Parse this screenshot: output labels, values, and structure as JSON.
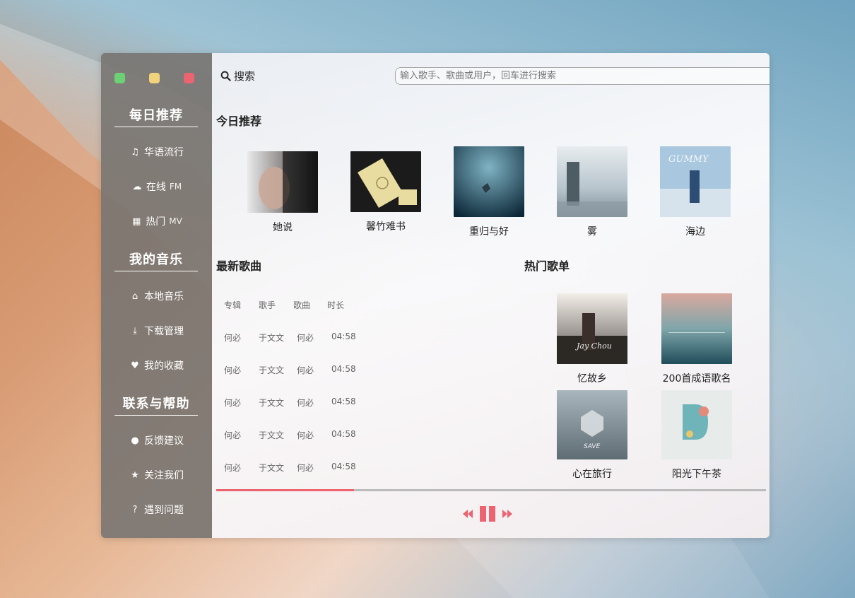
{
  "sidebar": {
    "sections": [
      {
        "title": "每日推荐",
        "items": [
          {
            "icon": "music-note-icon",
            "label": "华语流行",
            "en": ""
          },
          {
            "icon": "cloud-icon",
            "label": "在线",
            "en": "FM"
          },
          {
            "icon": "film-icon",
            "label": "热门",
            "en": "MV"
          }
        ]
      },
      {
        "title": "我的音乐",
        "items": [
          {
            "icon": "home-icon",
            "label": "本地音乐",
            "en": ""
          },
          {
            "icon": "download-icon",
            "label": "下载管理",
            "en": ""
          },
          {
            "icon": "heart-icon",
            "label": "我的收藏",
            "en": ""
          }
        ]
      },
      {
        "title": "联系与帮助",
        "items": [
          {
            "icon": "comment-icon",
            "label": "反馈建议",
            "en": ""
          },
          {
            "icon": "star-icon",
            "label": "关注我们",
            "en": ""
          },
          {
            "icon": "question-icon",
            "label": "遇到问题",
            "en": ""
          }
        ]
      }
    ]
  },
  "search": {
    "label": "搜索",
    "placeholder": "输入歌手、歌曲或用户，回车进行搜索"
  },
  "today": {
    "title": "今日推荐",
    "albums": [
      {
        "name": "她说"
      },
      {
        "name": "馨竹难书"
      },
      {
        "name": "重归与好"
      },
      {
        "name": "雾"
      },
      {
        "name": "海边"
      }
    ]
  },
  "newest": {
    "title": "最新歌曲",
    "columns": [
      "专辑",
      "歌手",
      "歌曲",
      "时长"
    ],
    "rows": [
      [
        "何必",
        "于文文",
        "何必",
        "04:58"
      ],
      [
        "何必",
        "于文文",
        "何必",
        "04:58"
      ],
      [
        "何必",
        "于文文",
        "何必",
        "04:58"
      ],
      [
        "何必",
        "于文文",
        "何必",
        "04:58"
      ],
      [
        "何必",
        "于文文",
        "何必",
        "04:58"
      ]
    ]
  },
  "hot_playlists": {
    "title": "热门歌单",
    "items": [
      {
        "name": "忆故乡"
      },
      {
        "name": "200首成语歌名"
      },
      {
        "name": "心在旅行"
      },
      {
        "name": "阳光下午茶"
      }
    ]
  },
  "player": {
    "progress": 0.25
  },
  "colors": {
    "accent": "#ec6470",
    "sidebar": "#78746f"
  }
}
